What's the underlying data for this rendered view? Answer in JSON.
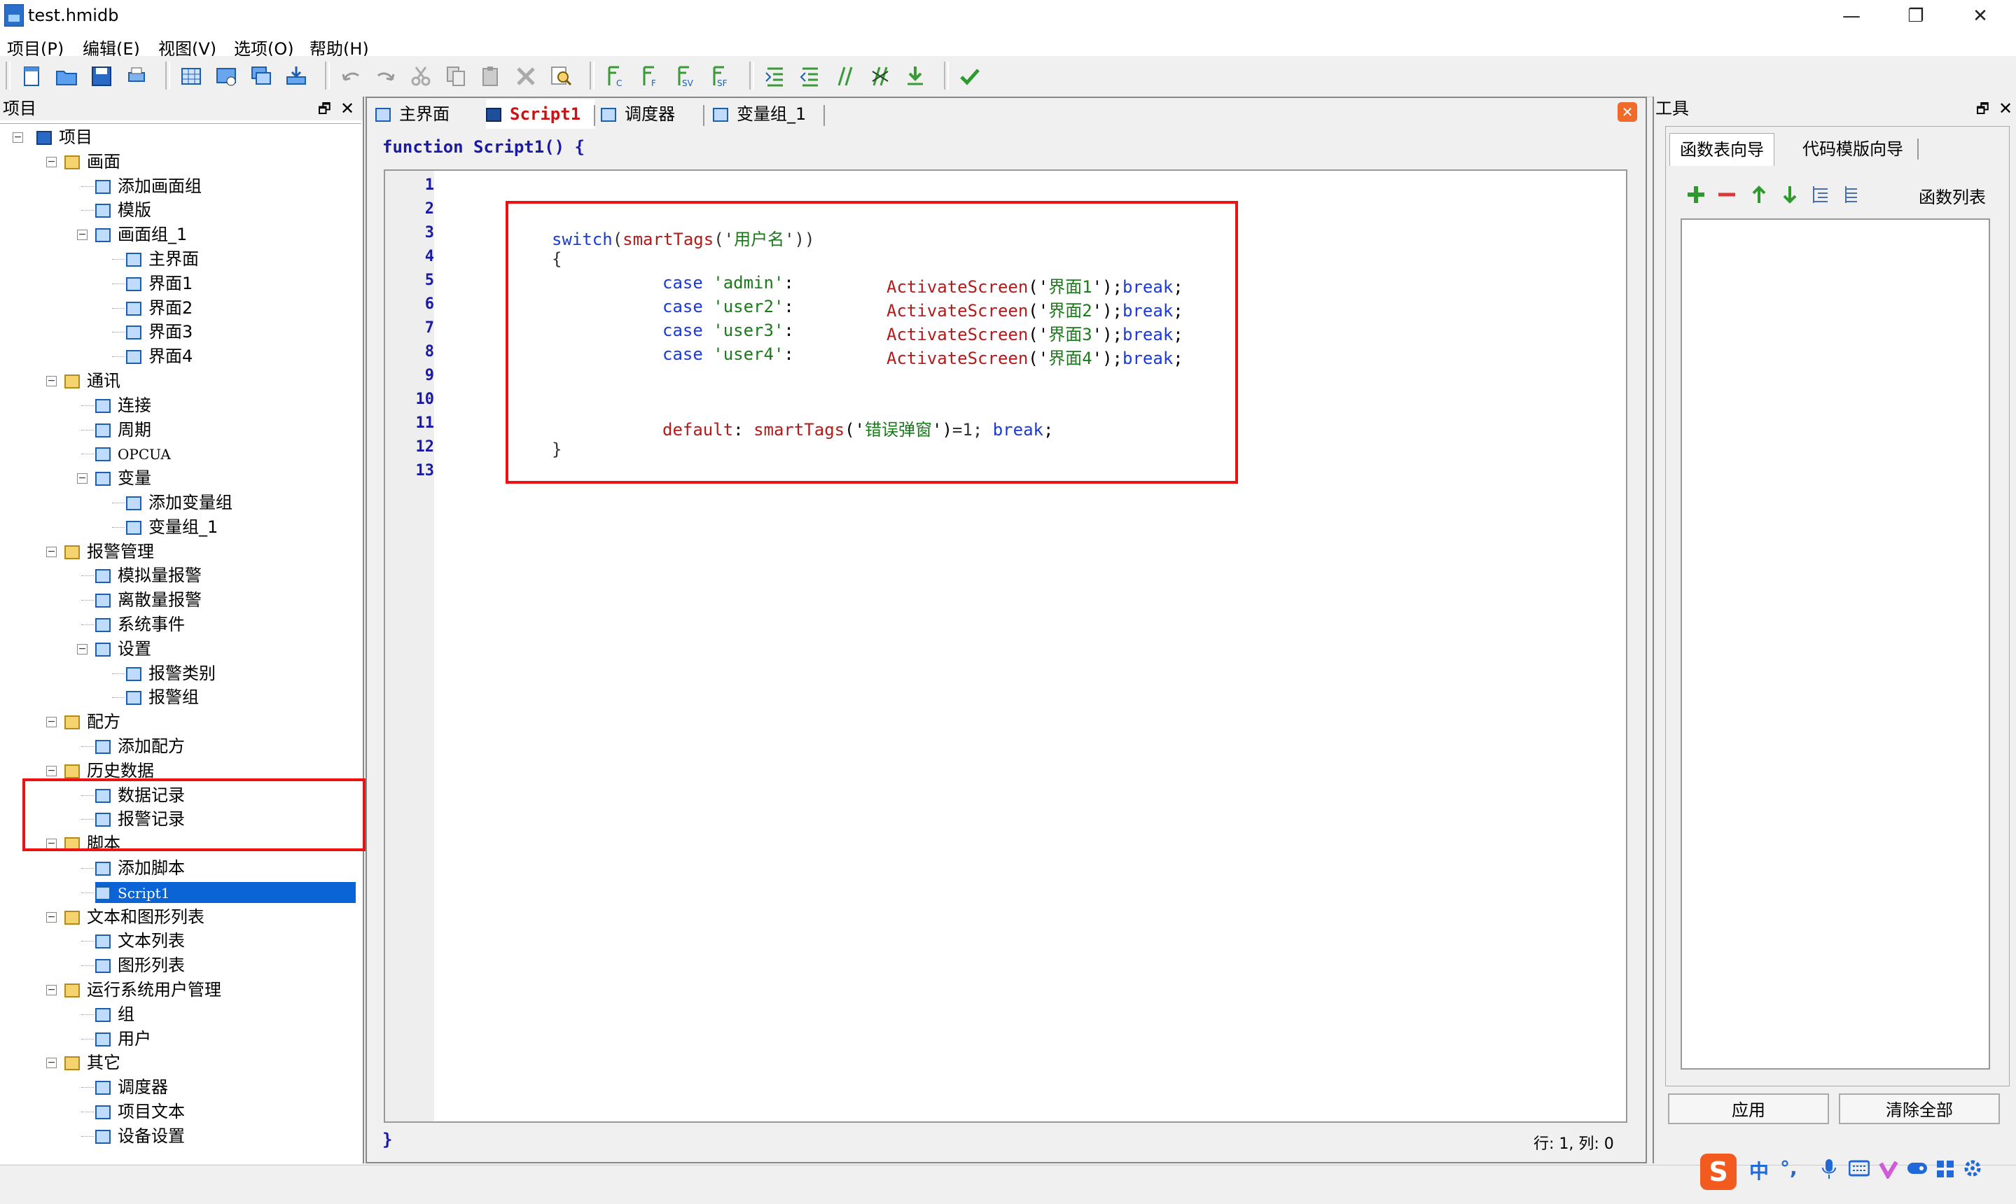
{
  "window": {
    "title": "test.hmidb",
    "minimize": "—",
    "restore": "❐",
    "close": "✕"
  },
  "menu": [
    "项目(P)",
    "编辑(E)",
    "视图(V)",
    "选项(O)",
    "帮助(H)"
  ],
  "project_panel": {
    "title": "项目",
    "pin": "🗗",
    "close": "✕"
  },
  "tree": {
    "root": "项目",
    "items": [
      {
        "label": "画面",
        "level": 1
      },
      {
        "label": "添加画面组",
        "level": 2
      },
      {
        "label": "模版",
        "level": 2
      },
      {
        "label": "画面组_1",
        "level": 2
      },
      {
        "label": "主界面",
        "level": 3
      },
      {
        "label": "界面1",
        "level": 3
      },
      {
        "label": "界面2",
        "level": 3
      },
      {
        "label": "界面3",
        "level": 3
      },
      {
        "label": "界面4",
        "level": 3
      },
      {
        "label": "通讯",
        "level": 1
      },
      {
        "label": "连接",
        "level": 2
      },
      {
        "label": "周期",
        "level": 2
      },
      {
        "label": "OPCUA",
        "level": 2
      },
      {
        "label": "变量",
        "level": 2
      },
      {
        "label": "添加变量组",
        "level": 3
      },
      {
        "label": "变量组_1",
        "level": 3
      },
      {
        "label": "报警管理",
        "level": 1
      },
      {
        "label": "模拟量报警",
        "level": 2
      },
      {
        "label": "离散量报警",
        "level": 2
      },
      {
        "label": "系统事件",
        "level": 2
      },
      {
        "label": "设置",
        "level": 2
      },
      {
        "label": "报警类别",
        "level": 3
      },
      {
        "label": "报警组",
        "level": 3
      },
      {
        "label": "配方",
        "level": 1
      },
      {
        "label": "添加配方",
        "level": 2
      },
      {
        "label": "历史数据",
        "level": 1
      },
      {
        "label": "数据记录",
        "level": 2
      },
      {
        "label": "报警记录",
        "level": 2
      },
      {
        "label": "脚本",
        "level": 1
      },
      {
        "label": "添加脚本",
        "level": 2
      },
      {
        "label": "Script1",
        "level": 2,
        "selected": true
      },
      {
        "label": "文本和图形列表",
        "level": 1
      },
      {
        "label": "文本列表",
        "level": 2
      },
      {
        "label": "图形列表",
        "level": 2
      },
      {
        "label": "运行系统用户管理",
        "level": 1
      },
      {
        "label": "组",
        "level": 2
      },
      {
        "label": "用户",
        "level": 2
      },
      {
        "label": "其它",
        "level": 1
      },
      {
        "label": "调度器",
        "level": 2
      },
      {
        "label": "项目文本",
        "level": 2
      },
      {
        "label": "设备设置",
        "level": 2
      }
    ]
  },
  "editor": {
    "tabs": [
      {
        "label": "主界面",
        "active": false
      },
      {
        "label": "Script1",
        "active": true
      },
      {
        "label": "调度器",
        "active": false
      },
      {
        "label": "变量组_1",
        "active": false
      }
    ],
    "close_icon": "✕",
    "header": "function Script1() {",
    "footer": "}",
    "line_numbers": [
      "1",
      "2",
      "3",
      "4",
      "5",
      "6",
      "7",
      "8",
      "9",
      "10",
      "11",
      "12",
      "13"
    ],
    "code": {
      "l3": {
        "kw": "switch",
        "p1": "(",
        "fn": "smartTags",
        "p2": "('",
        "str": "用户名",
        "p3": "'))"
      },
      "l4": "{",
      "cases": [
        {
          "kw": "case",
          "val": "'admin'",
          "fn": "ActivateScreen",
          "str": "界面1",
          "brk": "break"
        },
        {
          "kw": "case",
          "val": "'user2'",
          "fn": "ActivateScreen",
          "str": "界面2",
          "brk": "break"
        },
        {
          "kw": "case",
          "val": "'user3'",
          "fn": "ActivateScreen",
          "str": "界面3",
          "brk": "break"
        },
        {
          "kw": "case",
          "val": "'user4'",
          "fn": "ActivateScreen",
          "str": "界面4",
          "brk": "break"
        }
      ],
      "l11": {
        "kw": "default",
        "fn": "smartTags",
        "str": "错误弹窗",
        "rest": "=1;",
        "brk": "break"
      },
      "l12": "}"
    },
    "status": "行: 1, 列: 0"
  },
  "tools_panel": {
    "title": "工具",
    "tabs": [
      "函数表向导",
      "代码模版向导"
    ],
    "function_list_label": "函数列表",
    "buttons": {
      "apply": "应用",
      "clear_all": "清除全部"
    }
  },
  "ime": {
    "logo": "S",
    "lang": "中",
    "punct": "°,"
  },
  "colors": {
    "highlight": "#e11111",
    "selection": "#0a64d6",
    "keyword": "#1a3ad6",
    "function": "#b31b1b",
    "string": "#1a7a1a"
  }
}
